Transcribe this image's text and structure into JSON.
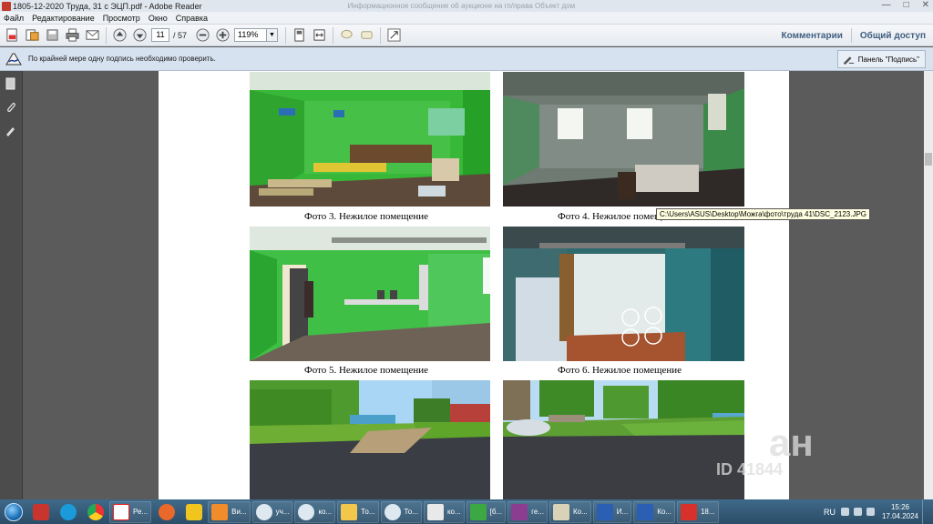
{
  "window": {
    "title": "1805-12-2020 Труда, 31 с ЭЦП.pdf - Adobe Reader",
    "faded_caption": "Информационное сообщение об аукционе на гп/права Объект дом"
  },
  "menu": [
    "Файл",
    "Редактирование",
    "Просмотр",
    "Окно",
    "Справка"
  ],
  "toolbar": {
    "page_current": "11",
    "page_total": "/ 57",
    "zoom": "119%",
    "comments_label": "Комментарии",
    "share_label": "Общий доступ"
  },
  "notification": {
    "text": "По крайней мере одну подпись необходимо проверить.",
    "signature_panel_label": "Панель \"Подпись\""
  },
  "document": {
    "captions": {
      "photo3": "Фото 3. Нежилое помещение",
      "photo4": "Фото 4. Нежилое помещение",
      "photo5": "Фото 5. Нежилое помещение",
      "photo6": "Фото 6. Нежилое помещение"
    },
    "tooltip": "C:\\Users\\ASUS\\Desktop\\Можга\\фото\\труда 41\\DSC_2123.JPG"
  },
  "watermark": {
    "brand": "ан",
    "id_text": "ID 41844"
  },
  "taskbar": {
    "buttons": [
      "Ре...",
      "Ви...",
      "уч...",
      "ко...",
      "То...",
      "То...",
      "ко...",
      "[б...",
      "ге...",
      "Ко...",
      "И...",
      "Ко...",
      "18..."
    ],
    "language": "RU",
    "time": "15:26",
    "date": "17.04.2024"
  },
  "colors": {
    "accent_blue": "#3f5f82",
    "taskbar": "#2b4d68",
    "wall_green": "#3fbf3f"
  }
}
